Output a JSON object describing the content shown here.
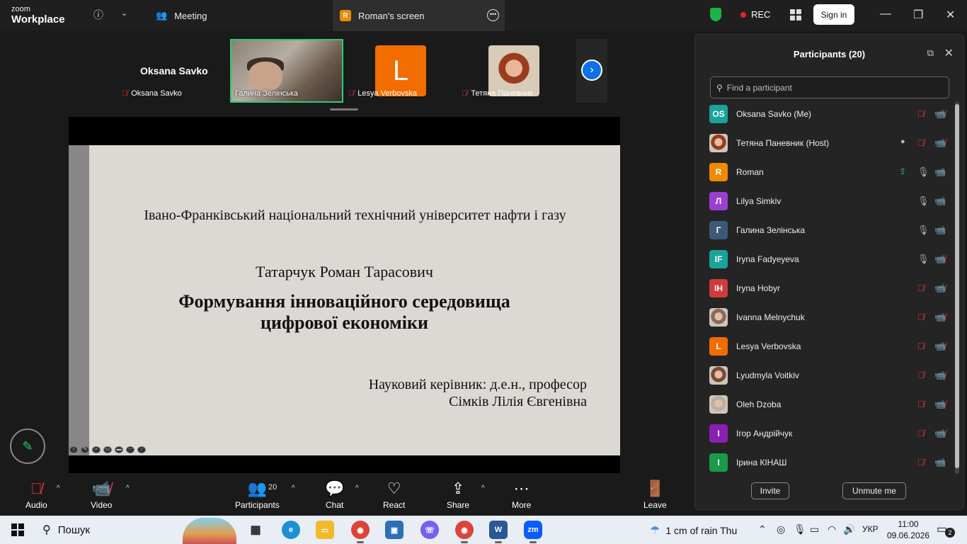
{
  "topbar": {
    "brand_line1": "zoom",
    "brand_line2": "Workplace",
    "tab_meeting": "Meeting",
    "tab_screen": "Roman's screen",
    "tab_screen_badge": "R",
    "rec_label": "REC",
    "signin_label": "Sign in"
  },
  "strip": {
    "self_big_name": "Oksana Savko",
    "tiles": [
      {
        "name": "Oksana Savko"
      },
      {
        "name": "Галина Зелінська"
      },
      {
        "name": "Lesya Verbovska",
        "initial": "L"
      },
      {
        "name": "Тетяна Паневник"
      }
    ]
  },
  "slide": {
    "university": "Івано-Франківський національний технічний університет нафти і газу",
    "author": "Татарчук Роман Тарасович",
    "title_line1": "Формування інноваційного середовища",
    "title_line2": "цифрової економіки",
    "supervisor_line1": "Науковий керівник: д.е.н., професор",
    "supervisor_line2": "Сімків Лілія Євгенівна"
  },
  "panel": {
    "title": "Participants (20)",
    "search_placeholder": "Find a participant",
    "invite_label": "Invite",
    "unmute_label": "Unmute me",
    "participants": [
      {
        "name": "Oksana Savko (Me)",
        "initials": "OS",
        "color": "#1aa39a",
        "mic": "muted",
        "cam": "off"
      },
      {
        "name": "Тетяна Паневник (Host)",
        "initials": "",
        "color": "#9a3d1e",
        "mic": "muted",
        "cam": "off",
        "photo": true,
        "recording": true
      },
      {
        "name": "Roman",
        "initials": "R",
        "color": "#f08a00",
        "mic": "on",
        "cam": "on",
        "sharing": true
      },
      {
        "name": "Lilya Simkiv",
        "initials": "Л",
        "color": "#9b3fd1",
        "mic": "on",
        "cam": "on"
      },
      {
        "name": "Галина Зелінська",
        "initials": "Г",
        "color": "#3e5878",
        "mic": "on",
        "cam": "on"
      },
      {
        "name": "Iryna Fadyeyeva",
        "initials": "IF",
        "color": "#1aa39a",
        "mic": "on",
        "cam": "off"
      },
      {
        "name": "Iryna Hobyr",
        "initials": "IH",
        "color": "#d13a3a",
        "mic": "muted",
        "cam": "off"
      },
      {
        "name": "Ivanna Melnychuk",
        "initials": "",
        "color": "#8a6a5a",
        "mic": "muted",
        "cam": "off",
        "photo": true
      },
      {
        "name": "Lesya Verbovska",
        "initials": "L",
        "color": "#f26d00",
        "mic": "muted",
        "cam": "off"
      },
      {
        "name": "Lyudmyla Voitkiv",
        "initials": "",
        "color": "#7a4a3a",
        "mic": "muted",
        "cam": "off",
        "photo": true
      },
      {
        "name": "Oleh Dzoba",
        "initials": "",
        "color": "#b8b0a8",
        "mic": "muted",
        "cam": "off",
        "photo": true
      },
      {
        "name": "Ігор Андрійчук",
        "initials": "І",
        "color": "#8b1fb3",
        "mic": "muted",
        "cam": "off"
      },
      {
        "name": "Ірина КІНАШ",
        "initials": "І",
        "color": "#1a9a4a",
        "mic": "muted",
        "cam": "on"
      }
    ]
  },
  "toolbar": {
    "audio": "Audio",
    "video": "Video",
    "participants": "Participants",
    "participants_count": "20",
    "chat": "Chat",
    "react": "React",
    "share": "Share",
    "more": "More",
    "leave": "Leave"
  },
  "taskbar": {
    "search_label": "Пошук",
    "weather": "1 cm of rain Thu",
    "lang": "УКР",
    "time": "11:00",
    "date": "09.06.2026",
    "notifications": "2"
  }
}
